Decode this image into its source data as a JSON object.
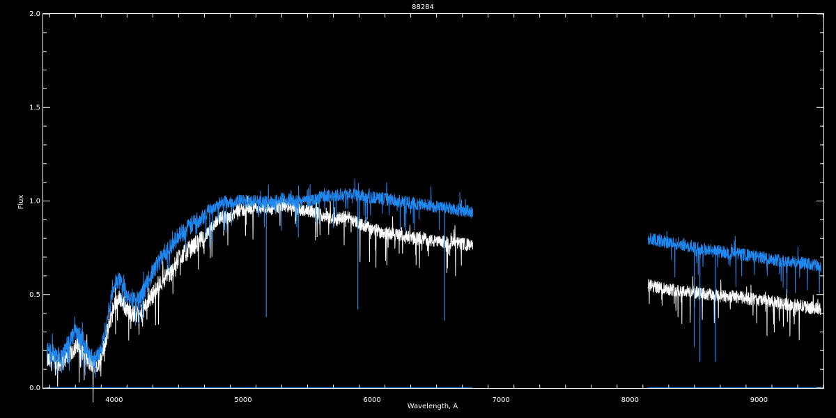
{
  "chart_data": {
    "type": "line",
    "title": "88284",
    "xlabel": "Wavelength, A",
    "ylabel": "Flux",
    "xlim": [
      3450,
      9500
    ],
    "ylim": [
      0.0,
      2.0
    ],
    "x_ticks": [
      4000,
      5000,
      6000,
      7000,
      8000,
      9000
    ],
    "x_tick_labels": [
      "4000",
      "5000",
      "6000",
      "7000",
      "8000",
      "9000"
    ],
    "y_ticks": [
      0.0,
      0.5,
      1.0,
      1.5,
      2.0
    ],
    "y_tick_labels": [
      "0.0",
      "0.5",
      "1.0",
      "1.5",
      "2.0"
    ],
    "grid": false,
    "background": "#000000",
    "series": [
      {
        "color": "#ffffff",
        "segments": [
          {
            "x": [
              3480,
              3550,
              3600,
              3650,
              3700,
              3750,
              3800,
              3850,
              3900,
              3950,
              4000,
              4050,
              4100,
              4150,
              4200,
              4250,
              4300,
              4350,
              4400,
              4450,
              4500,
              4550,
              4600,
              4650,
              4700,
              4750,
              4800,
              4850,
              4900,
              4950,
              5000,
              5100,
              5200,
              5300,
              5400,
              5500,
              5600,
              5700,
              5800,
              5900,
              6000,
              6100,
              6200,
              6300,
              6400,
              6500,
              6600,
              6700,
              6780
            ],
            "y": [
              0.15,
              0.13,
              0.14,
              0.18,
              0.22,
              0.2,
              0.14,
              0.12,
              0.16,
              0.3,
              0.45,
              0.48,
              0.42,
              0.4,
              0.38,
              0.45,
              0.5,
              0.55,
              0.6,
              0.62,
              0.7,
              0.72,
              0.75,
              0.78,
              0.8,
              0.85,
              0.9,
              0.92,
              0.9,
              0.95,
              0.95,
              0.97,
              0.95,
              0.98,
              0.96,
              0.95,
              0.93,
              0.9,
              0.92,
              0.88,
              0.85,
              0.83,
              0.82,
              0.8,
              0.8,
              0.78,
              0.78,
              0.77,
              0.76
            ]
          },
          {
            "x": [
              8140,
              8200,
              8300,
              8400,
              8500,
              8600,
              8700,
              8800,
              8900,
              9000,
              9100,
              9200,
              9300,
              9400,
              9480
            ],
            "y": [
              0.55,
              0.54,
              0.53,
              0.52,
              0.51,
              0.5,
              0.49,
              0.49,
              0.48,
              0.47,
              0.46,
              0.45,
              0.44,
              0.43,
              0.42
            ]
          }
        ]
      },
      {
        "color": "#1e87f0",
        "segments": [
          {
            "x": [
              3480,
              3550,
              3600,
              3650,
              3700,
              3750,
              3800,
              3850,
              3900,
              3950,
              4000,
              4050,
              4100,
              4150,
              4200,
              4250,
              4300,
              4350,
              4400,
              4450,
              4500,
              4550,
              4600,
              4650,
              4700,
              4750,
              4800,
              4850,
              4900,
              4950,
              5000,
              5100,
              5200,
              5300,
              5400,
              5500,
              5600,
              5700,
              5800,
              5900,
              6000,
              6100,
              6200,
              6300,
              6400,
              6500,
              6600,
              6700,
              6780
            ],
            "y": [
              0.2,
              0.17,
              0.18,
              0.25,
              0.3,
              0.27,
              0.18,
              0.15,
              0.2,
              0.38,
              0.55,
              0.58,
              0.5,
              0.48,
              0.47,
              0.55,
              0.62,
              0.68,
              0.73,
              0.76,
              0.82,
              0.84,
              0.87,
              0.9,
              0.93,
              0.96,
              0.98,
              1.0,
              0.99,
              1.0,
              1.0,
              1.0,
              0.99,
              1.01,
              1.0,
              1.0,
              1.02,
              1.03,
              1.04,
              1.03,
              1.02,
              1.01,
              1.0,
              0.99,
              0.98,
              0.97,
              0.96,
              0.95,
              0.94
            ]
          },
          {
            "x": [
              8140,
              8200,
              8300,
              8400,
              8500,
              8600,
              8700,
              8800,
              8900,
              9000,
              9100,
              9200,
              9300,
              9400,
              9480
            ],
            "y": [
              0.8,
              0.79,
              0.78,
              0.77,
              0.75,
              0.74,
              0.73,
              0.72,
              0.71,
              0.7,
              0.69,
              0.68,
              0.67,
              0.66,
              0.65
            ]
          }
        ]
      }
    ],
    "absorption_lines": [
      {
        "x": 5180,
        "y": 0.38,
        "color": "#1e87f0"
      },
      {
        "x": 5890,
        "y": 0.42,
        "color": "#1e87f0"
      },
      {
        "x": 6563,
        "y": 0.36,
        "color": "#1e87f0"
      },
      {
        "x": 8498,
        "y": 0.22,
        "color": "#1e87f0"
      },
      {
        "x": 8542,
        "y": 0.14,
        "color": "#1e87f0"
      },
      {
        "x": 8662,
        "y": 0.14,
        "color": "#1e87f0"
      }
    ]
  }
}
